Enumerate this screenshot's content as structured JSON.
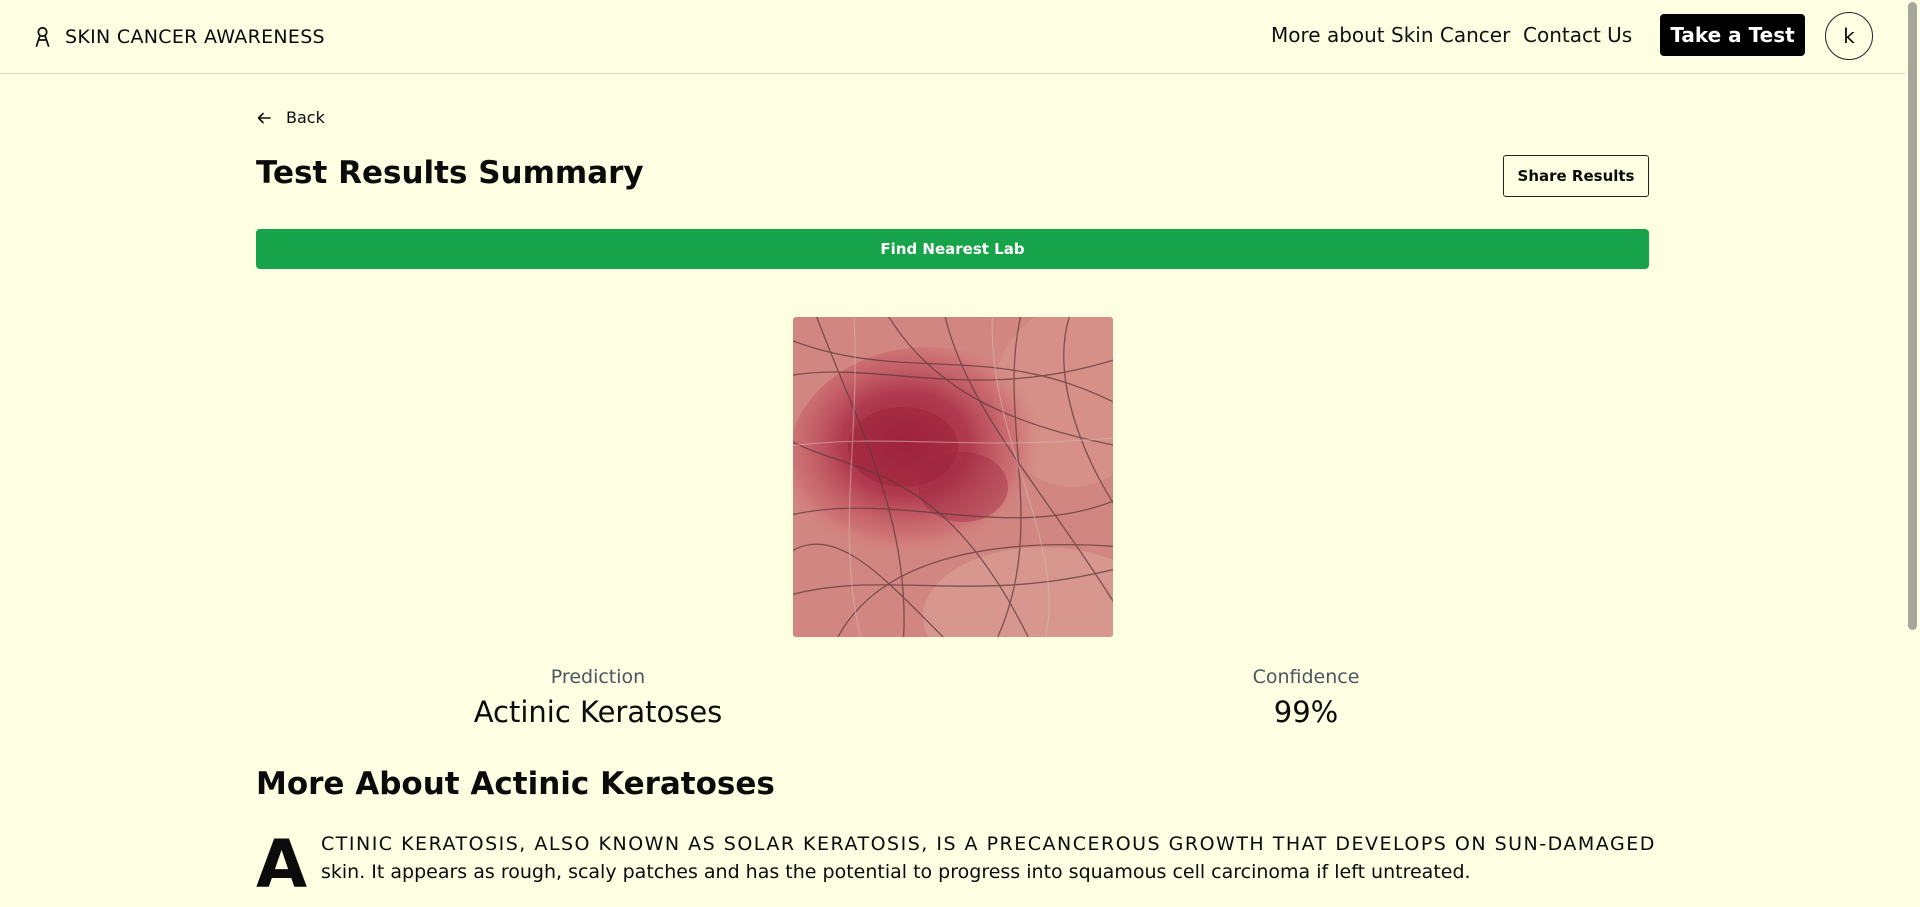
{
  "brand": {
    "name": "SKIN CANCER AWARENESS",
    "icon": "awareness-ribbon-icon"
  },
  "nav": {
    "more_label": "More about Skin Cancer",
    "contact_label": "Contact Us",
    "test_label": "Take a Test",
    "avatar_initial": "k"
  },
  "page": {
    "back_label": "Back",
    "title": "Test Results Summary",
    "share_label": "Share Results",
    "lab_label": "Find Nearest Lab"
  },
  "result": {
    "prediction_label": "Prediction",
    "prediction_value": "Actinic Keratoses",
    "confidence_label": "Confidence",
    "confidence_value": "99%"
  },
  "about": {
    "title": "More About Actinic Keratoses",
    "dropcap": "A",
    "lead": "CTINIC KERATOSIS, ALSO KNOWN AS SOLAR KERATOSIS, IS A PRECANCEROUS GROWTH THAT DEVELOPS ON SUN-DAMAGED",
    "body": "skin. It appears as rough, scaly patches and has the potential to progress into squamous cell carcinoma if left untreated."
  },
  "colors": {
    "background": "#fefee2",
    "accent_green": "#16a34a",
    "primary_black": "#000000"
  }
}
